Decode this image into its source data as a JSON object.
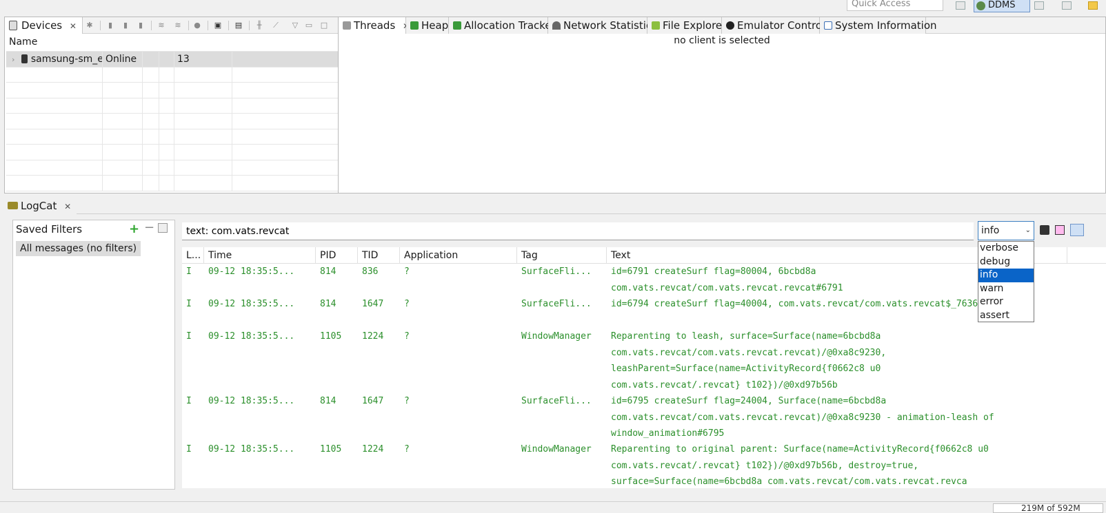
{
  "toolbar": {
    "quick_access_placeholder": "Quick Access",
    "perspective": "DDMS"
  },
  "devices_view": {
    "tab_label": "Devices",
    "table_header": "Name",
    "devices": [
      {
        "name": "samsung-sm_e",
        "status": "Online",
        "extra": "13"
      }
    ]
  },
  "threads_view": {
    "tabs": [
      "Threads",
      "Heap",
      "Allocation Tracker",
      "Network Statistics",
      "File Explorer",
      "Emulator Control",
      "System Information"
    ],
    "empty_message": "no client is selected"
  },
  "logcat": {
    "tab_label": "LogCat",
    "saved_filters_title": "Saved Filters",
    "filters": [
      "All messages (no filters)"
    ],
    "search_value": "text: com.vats.revcat",
    "level_selected": "info",
    "levels": [
      "verbose",
      "debug",
      "info",
      "warn",
      "error",
      "assert"
    ],
    "columns": [
      "L...",
      "Time",
      "PID",
      "TID",
      "Application",
      "Tag",
      "Text"
    ],
    "rows": [
      {
        "level": "I",
        "time": "09-12 18:35:5...",
        "pid": "814",
        "tid": "836",
        "app": "?",
        "tag": "SurfaceFli...",
        "text": "id=6791 createSurf flag=80004, 6bcbd8a com.vats.revcat/com.vats.revcat.revcat#6791"
      },
      {
        "level": "I",
        "time": "09-12 18:35:5...",
        "pid": "814",
        "tid": "1647",
        "app": "?",
        "tag": "SurfaceFli...",
        "text": "id=6794 createSurf flag=40004, com.vats.revcat/com.vats.revcat$_7636#6794"
      },
      {
        "level": "I",
        "time": "09-12 18:35:5...",
        "pid": "1105",
        "tid": "1224",
        "app": "?",
        "tag": "WindowManager",
        "text": "Reparenting to leash, surface=Surface(name=6bcbd8a com.vats.revcat/com.vats.revcat.revcat)/@0xa8c9230, leashParent=Surface(name=ActivityRecord{f0662c8 u0 com.vats.revcat/.revcat} t102})/@0xd97b56b"
      },
      {
        "level": "I",
        "time": "09-12 18:35:5...",
        "pid": "814",
        "tid": "1647",
        "app": "?",
        "tag": "SurfaceFli...",
        "text": "id=6795 createSurf flag=24004, Surface(name=6bcbd8a com.vats.revcat/com.vats.revcat.revcat)/@0xa8c9230 - animation-leash of window_animation#6795"
      },
      {
        "level": "I",
        "time": "09-12 18:35:5...",
        "pid": "1105",
        "tid": "1224",
        "app": "?",
        "tag": "WindowManager",
        "text": "Reparenting to original parent: Surface(name=ActivityRecord{f0662c8 u0 com.vats.revcat/.revcat} t102})/@0xd97b56b, destroy=true, surface=Surface(name=6bcbd8a com.vats.revcat/com.vats.revcat.revca"
      }
    ]
  },
  "status": {
    "heap": "219M of 592M"
  }
}
